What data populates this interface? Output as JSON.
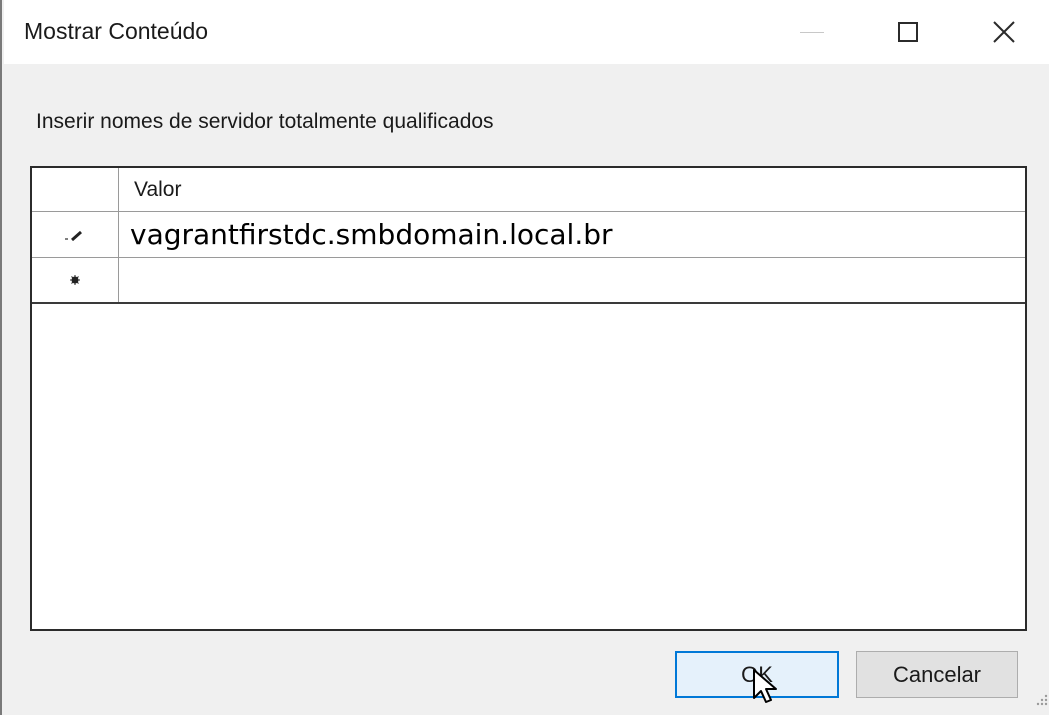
{
  "window": {
    "title": "Mostrar Conteúdo"
  },
  "titlebar_icons": {
    "minimize": "minimize-icon",
    "maximize": "maximize-icon",
    "close": "close-icon"
  },
  "instruction": "Inserir nomes de servidor totalmente qualificados",
  "grid": {
    "column_header": "Valor",
    "rows": [
      {
        "marker_icon": "pencil-icon",
        "value": "vagrantfirstdc.smbdomain.local.br"
      },
      {
        "marker_icon": "new-row-icon",
        "value": ""
      }
    ]
  },
  "buttons": {
    "ok": "OK",
    "cancel": "Cancelar"
  },
  "colors": {
    "accent": "#0078d7",
    "ok_button_bg": "#e5f1fb",
    "dialog_bg": "#f0f0f0"
  }
}
